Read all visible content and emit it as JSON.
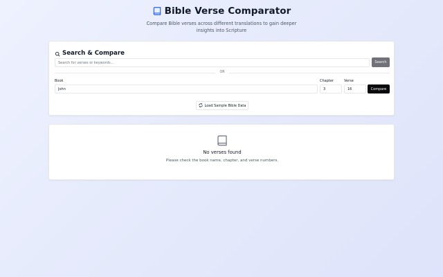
{
  "header": {
    "title": "Bible Verse Comparator",
    "subtitle": "Compare Bible verses across different translations to gain deeper insights into Scripture",
    "icon": "book-icon"
  },
  "search_card": {
    "title": "Search & Compare",
    "icon": "search-icon",
    "search_placeholder": "Search for verses or keywords...",
    "search_button": "Search",
    "divider_text": "OR",
    "book_label": "Book",
    "book_value": "John",
    "chapter_label": "Chapter",
    "chapter_value": "3",
    "verse_label": "Verse",
    "verse_value": "16",
    "compare_button": "Compare",
    "load_sample_button": "Load Sample Bible Data",
    "load_icon": "refresh-icon"
  },
  "results_card": {
    "icon": "book-icon",
    "empty_title": "No verses found",
    "empty_description": "Please check the book name, chapter, and verse numbers."
  },
  "colors": {
    "accent_dark": "#09090b",
    "search_button": "#71717a",
    "title_icon": "#2563eb"
  }
}
